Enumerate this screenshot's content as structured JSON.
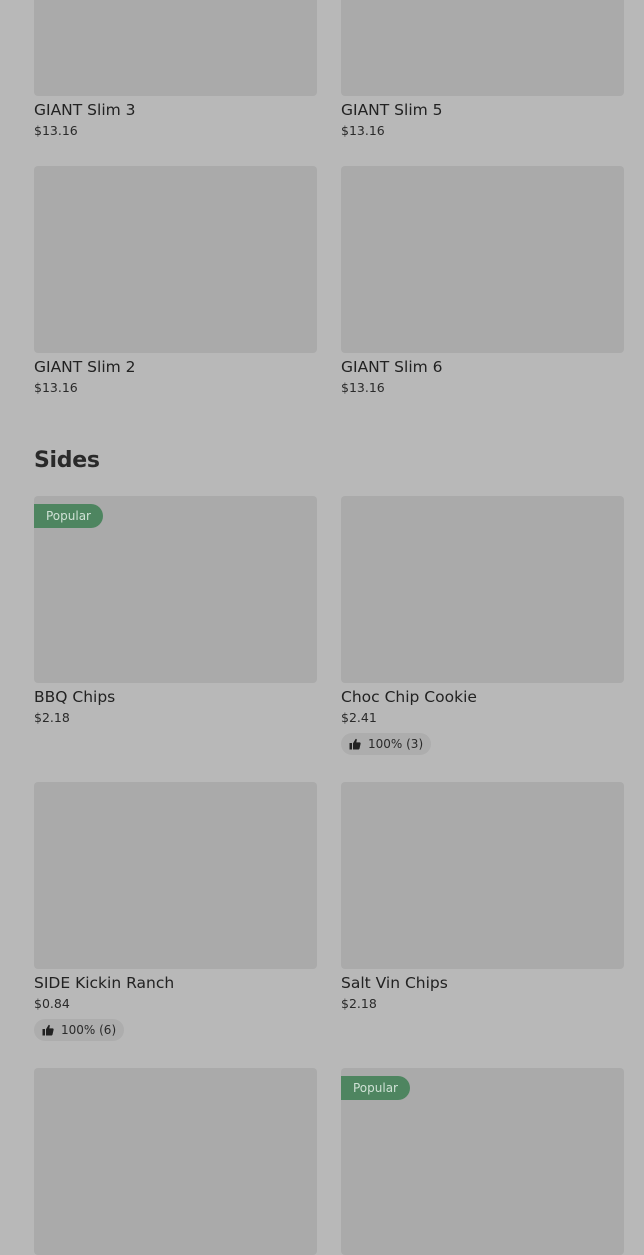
{
  "top_items": [
    {
      "name": "GIANT Slim 3",
      "price": "$13.16"
    },
    {
      "name": "GIANT Slim 5",
      "price": "$13.16"
    },
    {
      "name": "GIANT Slim 2",
      "price": "$13.16"
    },
    {
      "name": "GIANT Slim 6",
      "price": "$13.16"
    }
  ],
  "sides": {
    "title": "Sides",
    "items": [
      {
        "name": "BBQ Chips",
        "price": "$2.18",
        "badge": "Popular"
      },
      {
        "name": "Choc Chip Cookie",
        "price": "$2.41",
        "rating": "100% (3)"
      },
      {
        "name": "SIDE Kickin Ranch",
        "price": "$0.84",
        "rating": "100% (6)"
      },
      {
        "name": "Salt Vin Chips",
        "price": "$2.18"
      },
      {
        "badge": "Popular"
      }
    ]
  },
  "colors": {
    "badge_bg": "#4e8560",
    "overlay_bg": "#b8b8b8",
    "thumb_bg": "#aaaaaa"
  },
  "icons": {
    "rating": "thumbs-up-icon"
  }
}
